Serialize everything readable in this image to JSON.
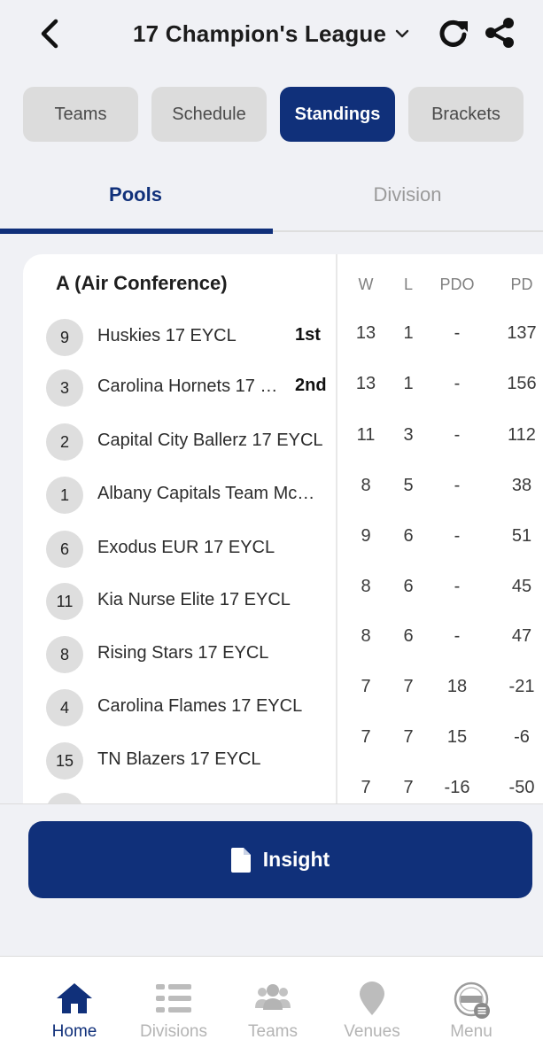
{
  "header": {
    "title": "17 Champion's League"
  },
  "tabs": [
    {
      "label": "Teams"
    },
    {
      "label": "Schedule"
    },
    {
      "label": "Standings",
      "active": true
    },
    {
      "label": "Brackets"
    }
  ],
  "subtabs": {
    "pools": "Pools",
    "division": "Division"
  },
  "standings": {
    "pool_title": "A (Air Conference)",
    "columns": [
      "W",
      "L",
      "PDO",
      "PD"
    ],
    "rows": [
      {
        "seed": "9",
        "team": "Huskies 17 EYCL",
        "place": "1st",
        "w": "13",
        "l": "1",
        "pdo": "-",
        "pd": "137"
      },
      {
        "seed": "3",
        "team": "Carolina Hornets 17 …",
        "place": "2nd",
        "w": "13",
        "l": "1",
        "pdo": "-",
        "pd": "156"
      },
      {
        "seed": "2",
        "team": "Capital City Ballerz 17 EYCL",
        "place": "",
        "w": "11",
        "l": "3",
        "pdo": "-",
        "pd": "112"
      },
      {
        "seed": "1",
        "team": "Albany Capitals Team Mc…",
        "place": "",
        "w": "8",
        "l": "5",
        "pdo": "-",
        "pd": "38"
      },
      {
        "seed": "6",
        "team": "Exodus EUR 17 EYCL",
        "place": "",
        "w": "9",
        "l": "6",
        "pdo": "-",
        "pd": "51"
      },
      {
        "seed": "11",
        "team": "Kia Nurse Elite 17 EYCL",
        "place": "",
        "w": "8",
        "l": "6",
        "pdo": "-",
        "pd": "45"
      },
      {
        "seed": "8",
        "team": "Rising Stars 17 EYCL",
        "place": "",
        "w": "8",
        "l": "6",
        "pdo": "-",
        "pd": "47"
      },
      {
        "seed": "4",
        "team": "Carolina Flames 17 EYCL",
        "place": "",
        "w": "7",
        "l": "7",
        "pdo": "18",
        "pd": "-21"
      },
      {
        "seed": "15",
        "team": "TN Blazers 17 EYCL",
        "place": "",
        "w": "7",
        "l": "7",
        "pdo": "15",
        "pd": "-6"
      },
      {
        "seed": "",
        "team": "",
        "place": "",
        "w": "7",
        "l": "7",
        "pdo": "-16",
        "pd": "-50"
      }
    ]
  },
  "insight": {
    "label": "Insight"
  },
  "bottom_nav": [
    {
      "label": "Home",
      "icon": "home-icon",
      "active": true
    },
    {
      "label": "Divisions",
      "icon": "divisions-icon"
    },
    {
      "label": "Teams",
      "icon": "teams-icon"
    },
    {
      "label": "Venues",
      "icon": "venue-pin-icon"
    },
    {
      "label": "Menu",
      "icon": "eybl-menu-icon"
    }
  ],
  "colors": {
    "primary": "#10307a",
    "tab_inactive": "#dcdcdc",
    "nav_inactive": "#b4b4b4",
    "background": "#f0f1f5"
  }
}
